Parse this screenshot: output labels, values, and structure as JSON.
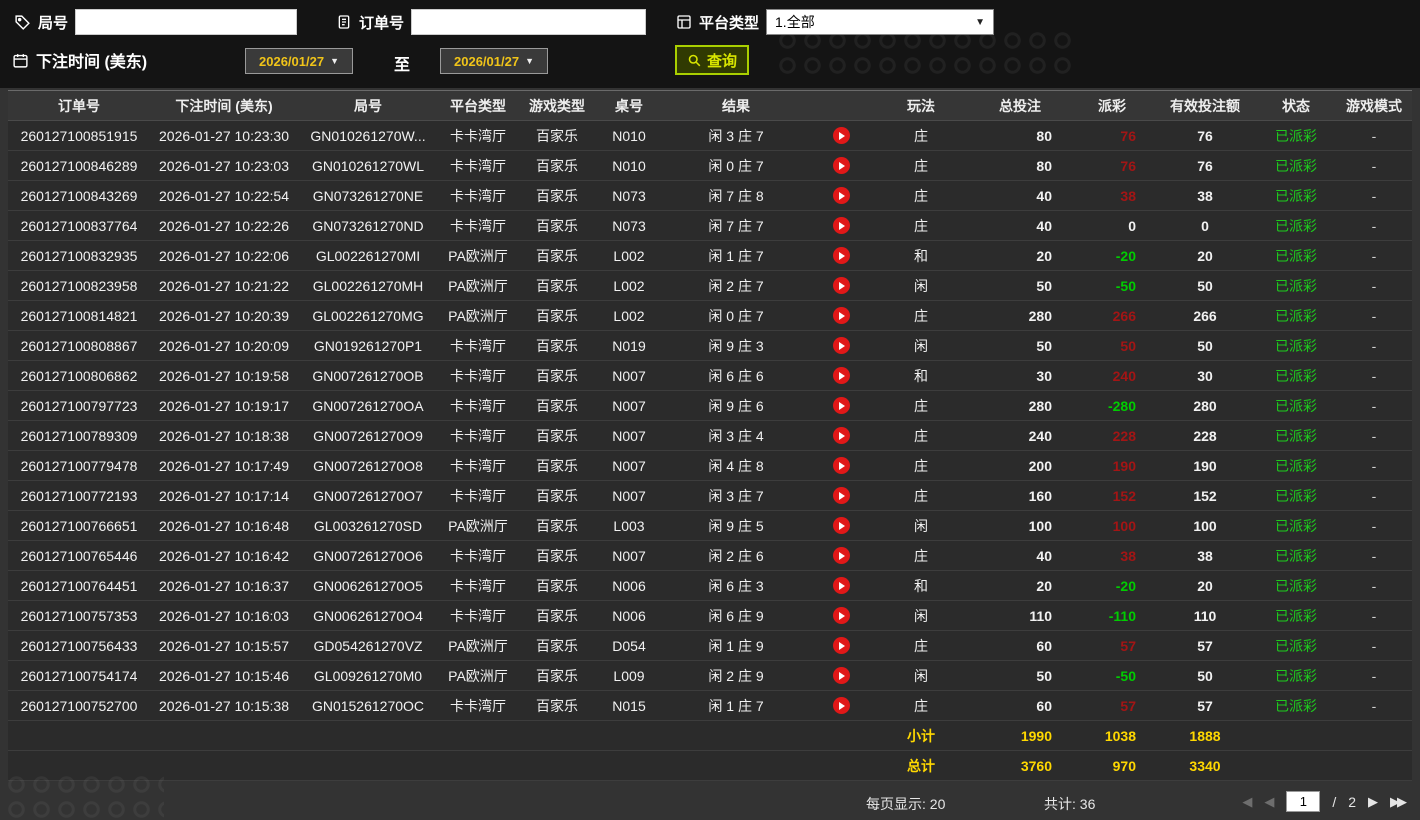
{
  "filters": {
    "game_no": {
      "label": "局号",
      "value": ""
    },
    "order_no": {
      "label": "订单号",
      "value": ""
    },
    "platform": {
      "label": "平台类型",
      "value": "1.全部"
    },
    "bet_time_label": "下注时间 (美东)",
    "date_from": "2026/01/27",
    "to_label": "至",
    "date_to": "2026/01/27",
    "search_label": "查询"
  },
  "table": {
    "headers": [
      "订单号",
      "下注时间 (美东)",
      "局号",
      "平台类型",
      "游戏类型",
      "桌号",
      "结果",
      "",
      "玩法",
      "总投注",
      "派彩",
      "有效投注额",
      "状态",
      "游戏模式"
    ],
    "rows": [
      {
        "order_no": "260127100851915",
        "bet_time": "2026-01-27 10:23:30",
        "game_no": "GN010261270W...",
        "platform": "卡卡湾厅",
        "game_type": "百家乐",
        "table_no": "N010",
        "result": "闲 3 庄 7",
        "bet_type": "庄",
        "total_bet": 80,
        "payout": 76,
        "valid_bet": 76,
        "status": "已派彩",
        "mode": "-"
      },
      {
        "order_no": "260127100846289",
        "bet_time": "2026-01-27 10:23:03",
        "game_no": "GN010261270WL",
        "platform": "卡卡湾厅",
        "game_type": "百家乐",
        "table_no": "N010",
        "result": "闲 0 庄 7",
        "bet_type": "庄",
        "total_bet": 80,
        "payout": 76,
        "valid_bet": 76,
        "status": "已派彩",
        "mode": "-"
      },
      {
        "order_no": "260127100843269",
        "bet_time": "2026-01-27 10:22:54",
        "game_no": "GN073261270NE",
        "platform": "卡卡湾厅",
        "game_type": "百家乐",
        "table_no": "N073",
        "result": "闲 7 庄 8",
        "bet_type": "庄",
        "total_bet": 40,
        "payout": 38,
        "valid_bet": 38,
        "status": "已派彩",
        "mode": "-"
      },
      {
        "order_no": "260127100837764",
        "bet_time": "2026-01-27 10:22:26",
        "game_no": "GN073261270ND",
        "platform": "卡卡湾厅",
        "game_type": "百家乐",
        "table_no": "N073",
        "result": "闲 7 庄 7",
        "bet_type": "庄",
        "total_bet": 40,
        "payout": 0,
        "valid_bet": 0,
        "status": "已派彩",
        "mode": "-"
      },
      {
        "order_no": "260127100832935",
        "bet_time": "2026-01-27 10:22:06",
        "game_no": "GL002261270MI",
        "platform": "PA欧洲厅",
        "game_type": "百家乐",
        "table_no": "L002",
        "result": "闲 1 庄 7",
        "bet_type": "和",
        "total_bet": 20,
        "payout": -20,
        "valid_bet": 20,
        "status": "已派彩",
        "mode": "-"
      },
      {
        "order_no": "260127100823958",
        "bet_time": "2026-01-27 10:21:22",
        "game_no": "GL002261270MH",
        "platform": "PA欧洲厅",
        "game_type": "百家乐",
        "table_no": "L002",
        "result": "闲 2 庄 7",
        "bet_type": "闲",
        "total_bet": 50,
        "payout": -50,
        "valid_bet": 50,
        "status": "已派彩",
        "mode": "-"
      },
      {
        "order_no": "260127100814821",
        "bet_time": "2026-01-27 10:20:39",
        "game_no": "GL002261270MG",
        "platform": "PA欧洲厅",
        "game_type": "百家乐",
        "table_no": "L002",
        "result": "闲 0 庄 7",
        "bet_type": "庄",
        "total_bet": 280,
        "payout": 266,
        "valid_bet": 266,
        "status": "已派彩",
        "mode": "-"
      },
      {
        "order_no": "260127100808867",
        "bet_time": "2026-01-27 10:20:09",
        "game_no": "GN019261270P1",
        "platform": "卡卡湾厅",
        "game_type": "百家乐",
        "table_no": "N019",
        "result": "闲 9 庄 3",
        "bet_type": "闲",
        "total_bet": 50,
        "payout": 50,
        "valid_bet": 50,
        "status": "已派彩",
        "mode": "-"
      },
      {
        "order_no": "260127100806862",
        "bet_time": "2026-01-27 10:19:58",
        "game_no": "GN007261270OB",
        "platform": "卡卡湾厅",
        "game_type": "百家乐",
        "table_no": "N007",
        "result": "闲 6 庄 6",
        "bet_type": "和",
        "total_bet": 30,
        "payout": 240,
        "valid_bet": 30,
        "status": "已派彩",
        "mode": "-"
      },
      {
        "order_no": "260127100797723",
        "bet_time": "2026-01-27 10:19:17",
        "game_no": "GN007261270OA",
        "platform": "卡卡湾厅",
        "game_type": "百家乐",
        "table_no": "N007",
        "result": "闲 9 庄 6",
        "bet_type": "庄",
        "total_bet": 280,
        "payout": -280,
        "valid_bet": 280,
        "status": "已派彩",
        "mode": "-"
      },
      {
        "order_no": "260127100789309",
        "bet_time": "2026-01-27 10:18:38",
        "game_no": "GN007261270O9",
        "platform": "卡卡湾厅",
        "game_type": "百家乐",
        "table_no": "N007",
        "result": "闲 3 庄 4",
        "bet_type": "庄",
        "total_bet": 240,
        "payout": 228,
        "valid_bet": 228,
        "status": "已派彩",
        "mode": "-"
      },
      {
        "order_no": "260127100779478",
        "bet_time": "2026-01-27 10:17:49",
        "game_no": "GN007261270O8",
        "platform": "卡卡湾厅",
        "game_type": "百家乐",
        "table_no": "N007",
        "result": "闲 4 庄 8",
        "bet_type": "庄",
        "total_bet": 200,
        "payout": 190,
        "valid_bet": 190,
        "status": "已派彩",
        "mode": "-"
      },
      {
        "order_no": "260127100772193",
        "bet_time": "2026-01-27 10:17:14",
        "game_no": "GN007261270O7",
        "platform": "卡卡湾厅",
        "game_type": "百家乐",
        "table_no": "N007",
        "result": "闲 3 庄 7",
        "bet_type": "庄",
        "total_bet": 160,
        "payout": 152,
        "valid_bet": 152,
        "status": "已派彩",
        "mode": "-"
      },
      {
        "order_no": "260127100766651",
        "bet_time": "2026-01-27 10:16:48",
        "game_no": "GL003261270SD",
        "platform": "PA欧洲厅",
        "game_type": "百家乐",
        "table_no": "L003",
        "result": "闲 9 庄 5",
        "bet_type": "闲",
        "total_bet": 100,
        "payout": 100,
        "valid_bet": 100,
        "status": "已派彩",
        "mode": "-"
      },
      {
        "order_no": "260127100765446",
        "bet_time": "2026-01-27 10:16:42",
        "game_no": "GN007261270O6",
        "platform": "卡卡湾厅",
        "game_type": "百家乐",
        "table_no": "N007",
        "result": "闲 2 庄 6",
        "bet_type": "庄",
        "total_bet": 40,
        "payout": 38,
        "valid_bet": 38,
        "status": "已派彩",
        "mode": "-"
      },
      {
        "order_no": "260127100764451",
        "bet_time": "2026-01-27 10:16:37",
        "game_no": "GN006261270O5",
        "platform": "卡卡湾厅",
        "game_type": "百家乐",
        "table_no": "N006",
        "result": "闲 6 庄 3",
        "bet_type": "和",
        "total_bet": 20,
        "payout": -20,
        "valid_bet": 20,
        "status": "已派彩",
        "mode": "-"
      },
      {
        "order_no": "260127100757353",
        "bet_time": "2026-01-27 10:16:03",
        "game_no": "GN006261270O4",
        "platform": "卡卡湾厅",
        "game_type": "百家乐",
        "table_no": "N006",
        "result": "闲 6 庄 9",
        "bet_type": "闲",
        "total_bet": 110,
        "payout": -110,
        "valid_bet": 110,
        "status": "已派彩",
        "mode": "-"
      },
      {
        "order_no": "260127100756433",
        "bet_time": "2026-01-27 10:15:57",
        "game_no": "GD054261270VZ",
        "platform": "PA欧洲厅",
        "game_type": "百家乐",
        "table_no": "D054",
        "result": "闲 1 庄 9",
        "bet_type": "庄",
        "total_bet": 60,
        "payout": 57,
        "valid_bet": 57,
        "status": "已派彩",
        "mode": "-"
      },
      {
        "order_no": "260127100754174",
        "bet_time": "2026-01-27 10:15:46",
        "game_no": "GL009261270M0",
        "platform": "PA欧洲厅",
        "game_type": "百家乐",
        "table_no": "L009",
        "result": "闲 2 庄 9",
        "bet_type": "闲",
        "total_bet": 50,
        "payout": -50,
        "valid_bet": 50,
        "status": "已派彩",
        "mode": "-"
      },
      {
        "order_no": "260127100752700",
        "bet_time": "2026-01-27 10:15:38",
        "game_no": "GN015261270OC",
        "platform": "卡卡湾厅",
        "game_type": "百家乐",
        "table_no": "N015",
        "result": "闲 1 庄 7",
        "bet_type": "庄",
        "total_bet": 60,
        "payout": 57,
        "valid_bet": 57,
        "status": "已派彩",
        "mode": "-"
      }
    ]
  },
  "summary": {
    "subtotal_label": "小计",
    "subtotal_bet": "1990",
    "subtotal_payout": "1038",
    "subtotal_valid": "1888",
    "total_label": "总计",
    "total_bet": "3760",
    "total_payout": "970",
    "total_valid": "3340"
  },
  "pagination": {
    "per_page_label": "每页显示:",
    "per_page_value": "20",
    "total_label": "共计:",
    "total_value": "36",
    "current_page": "1",
    "separator": "/",
    "total_pages": "2"
  }
}
